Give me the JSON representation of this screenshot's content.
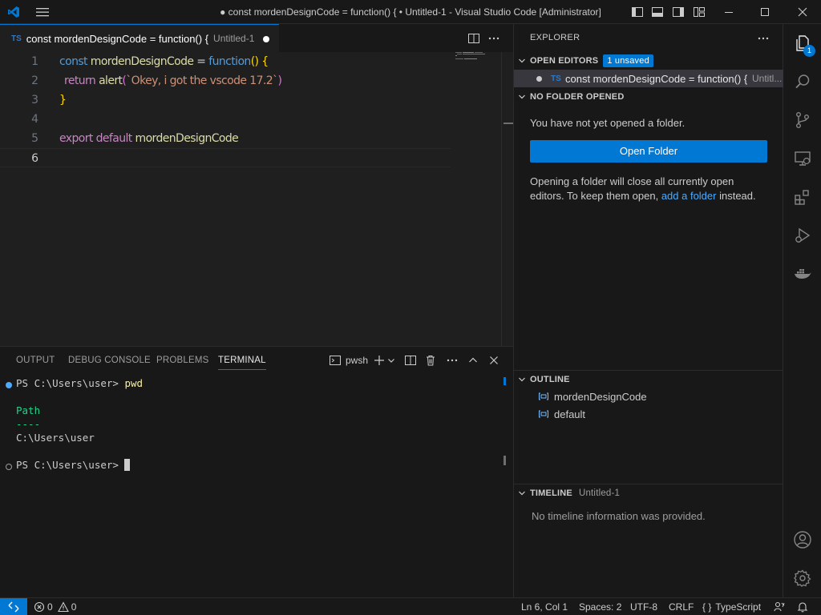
{
  "window": {
    "title": "● const mordenDesignCode = function() { • Untitled-1 - Visual Studio Code [Administrator]"
  },
  "editor_tab": {
    "language_badge": "TS",
    "title": "const mordenDesignCode = function() {",
    "description": "Untitled-1"
  },
  "editor": {
    "line_numbers": [
      "1",
      "2",
      "3",
      "4",
      "5",
      "6"
    ],
    "lines": {
      "l1_kw": "const",
      "l1_name": "mordenDesignCode",
      "l1_eq": " = ",
      "l1_fn": "function",
      "l1_paren": "()",
      "l1_brace": " {",
      "l2_kw": "return",
      "l2_fn": "alert",
      "l2_open": "(",
      "l2_str": "`Okey, i got the vscode 17.2`",
      "l2_close": ")",
      "l3_brace": "}",
      "l5_kw1": "export",
      "l5_kw2": "default",
      "l5_name": "mordenDesignCode"
    }
  },
  "panel": {
    "tabs": [
      "OUTPUT",
      "DEBUG CONSOLE",
      "PROBLEMS",
      "TERMINAL"
    ],
    "active_tab": "TERMINAL",
    "shell_label": "pwsh",
    "terminal": {
      "prompt1": "PS C:\\Users\\user> ",
      "cmd1": "pwd",
      "header": "Path",
      "underline": "----",
      "path": "C:\\Users\\user",
      "prompt2": "PS C:\\Users\\user> "
    }
  },
  "sidebar": {
    "title": "EXPLORER",
    "open_editors": {
      "label": "OPEN EDITORS",
      "badge": "1 unsaved",
      "file_badge": "TS",
      "file_name": "const mordenDesignCode = function() {",
      "file_desc": "Untitl..."
    },
    "no_folder": {
      "label": "NO FOLDER OPENED",
      "message": "You have not yet opened a folder.",
      "button": "Open Folder",
      "note_1": "Opening a folder will close all currently open",
      "note_2": "editors. To keep them open, ",
      "note_link": "add a folder",
      "note_3": " instead."
    },
    "outline": {
      "label": "OUTLINE",
      "items": [
        "mordenDesignCode",
        "default"
      ]
    },
    "timeline": {
      "label": "TIMELINE",
      "desc": "Untitled-1",
      "message": "No timeline information was provided."
    }
  },
  "activity_bar": {
    "explorer_badge": "1",
    "icons": [
      "explorer-icon",
      "search-icon",
      "source-control-icon",
      "remote-explorer-icon",
      "extensions-icon",
      "run-debug-icon",
      "docker-icon",
      "accounts-icon",
      "manage-gear-icon"
    ]
  },
  "status_bar": {
    "errors": "0",
    "warnings": "0",
    "cursor": "Ln 6, Col 1",
    "spaces": "Spaces: 2",
    "encoding": "UTF-8",
    "eol": "CRLF",
    "language_brackets": "{ }",
    "language": "TypeScript"
  },
  "colors": {
    "accent": "#0078d4",
    "background": "#1f1f1f",
    "chrome": "#181818",
    "link": "#4daafc"
  }
}
